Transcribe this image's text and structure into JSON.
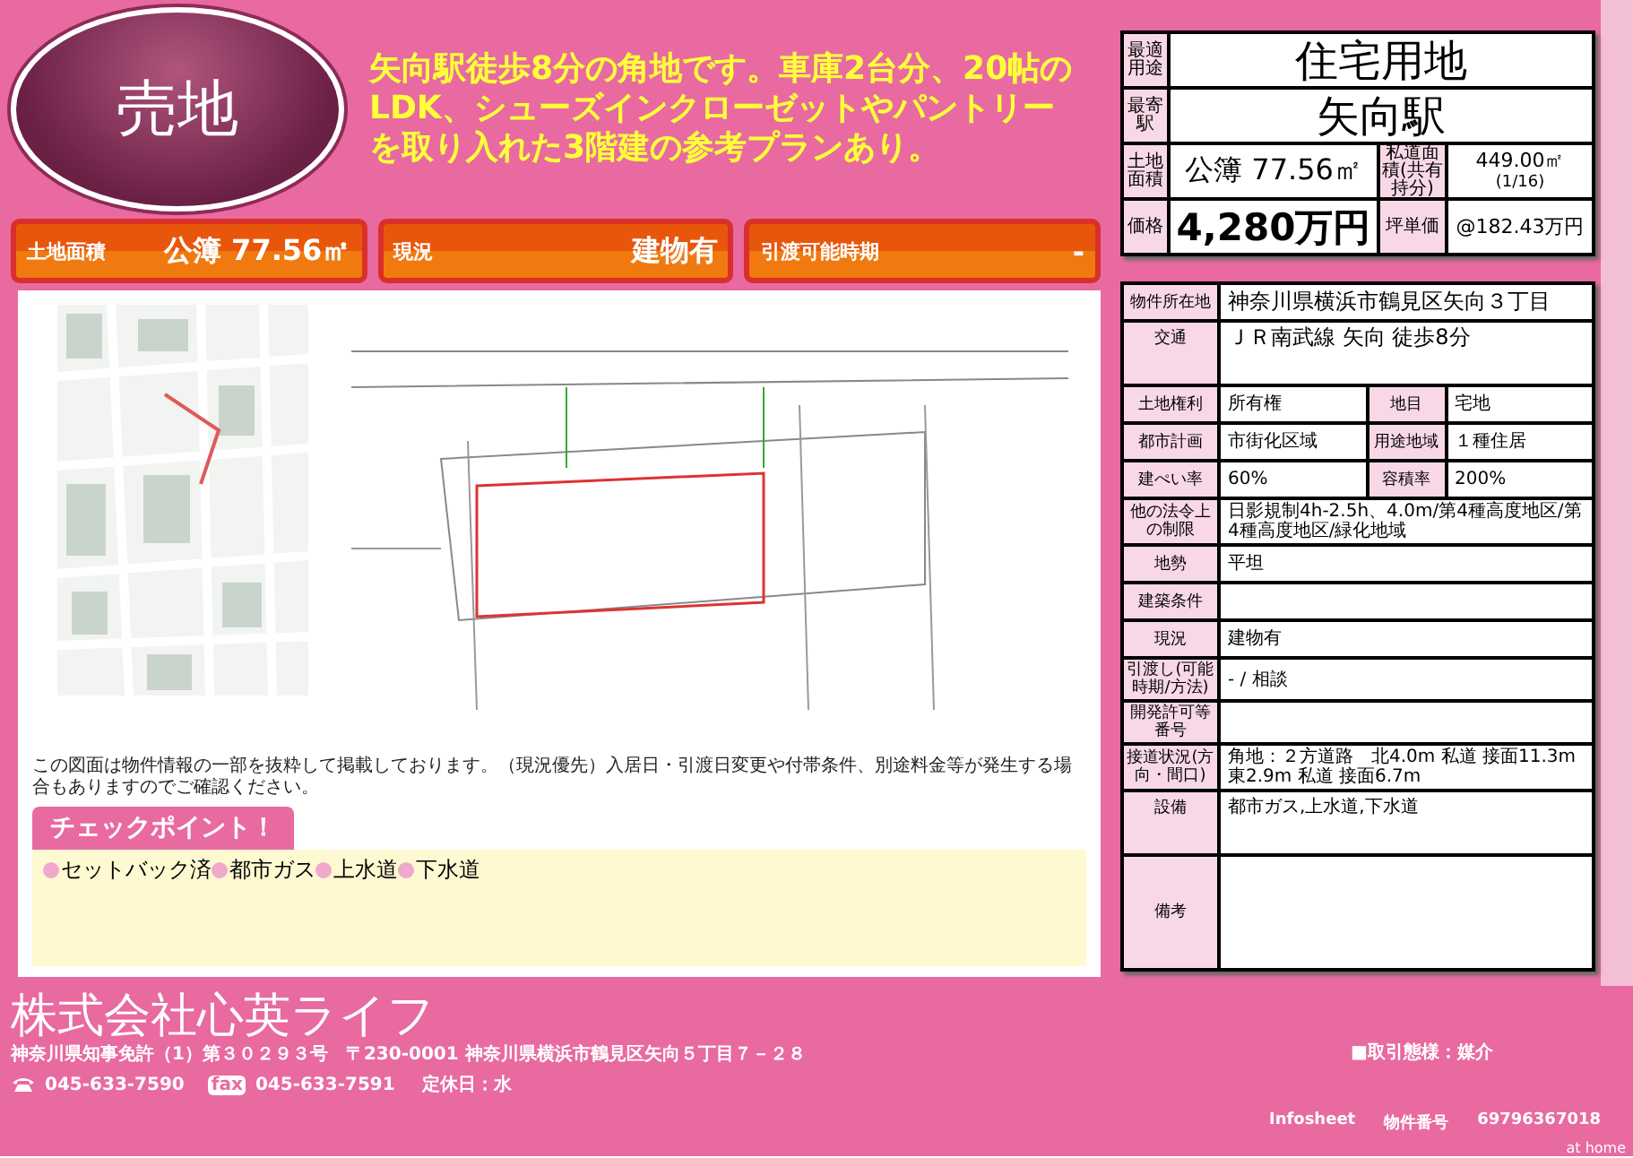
{
  "badge": "売地",
  "headline": "矢向駅徒歩8分の角地です。車庫2台分、20帖のLDK、シューズインクローゼットやパントリーを取り入れた3階建の参考プランあり。",
  "summary_bars": [
    {
      "label": "土地面積",
      "value": "公簿 77.56㎡"
    },
    {
      "label": "現況",
      "value": "建物有"
    },
    {
      "label": "引渡可能時期",
      "value": "-"
    }
  ],
  "notice": "この図面は物件情報の一部を抜粋して掲載しております。（現況優先）入居日・引渡日変更や付帯条件、別途料金等が発生する場合もありますのでご確認ください。",
  "checkpoints": {
    "title": "チェックポイント！",
    "items": [
      "セットバック済",
      "都市ガス",
      "上水道",
      "下水道"
    ]
  },
  "summary_table": {
    "type": {
      "label": "最適用途",
      "value": "住宅用地"
    },
    "station": {
      "label": "最寄駅",
      "value": "矢向駅"
    },
    "land_area": {
      "label": "土地面積",
      "value": "公簿 77.56㎡",
      "sub_label": "私道面積(共有持分)",
      "sub_value": "449.00㎡",
      "sub_note": "(1/16)"
    },
    "price": {
      "label": "価格",
      "value": "4,280万円",
      "sub_label": "坪単価",
      "sub_value": "@182.43万円"
    }
  },
  "details": [
    {
      "kind": "full",
      "label": "物件所在地",
      "value": "神奈川県横浜市鶴見区矢向３丁目"
    },
    {
      "kind": "tall",
      "label": "交通",
      "value": "ＪＲ南武線 矢向 徒歩8分"
    },
    {
      "kind": "pair",
      "label": "土地権利",
      "value": "所有権",
      "label_2": "地目",
      "value_2": "宅地"
    },
    {
      "kind": "pair",
      "label": "都市計画",
      "value": "市街化区域",
      "label_2": "用途地域",
      "value_2": "１種住居"
    },
    {
      "kind": "pair",
      "label": "建ぺい率",
      "value": "60%",
      "label_2": "容積率",
      "value_2": "200%"
    },
    {
      "kind": "full",
      "label": "他の法令上の制限",
      "value": "日影規制4h-2.5h、4.0m/第4種高度地区/第4種高度地区/緑化地域"
    },
    {
      "kind": "full",
      "label": "地勢",
      "value": "平坦"
    },
    {
      "kind": "full",
      "label": "建築条件"
    },
    {
      "kind": "full",
      "label": "現況",
      "value": "建物有"
    },
    {
      "kind": "full",
      "label": "引渡し(可能時期/方法)",
      "value": "- / 相談"
    },
    {
      "kind": "full",
      "label": "開発許可等番号"
    },
    {
      "kind": "full",
      "label": "接道状況(方向・間口)",
      "value": "角地：２方道路　北4.0m 私道 接面11.3m　東2.9m 私道 接面6.7m"
    },
    {
      "kind": "tall",
      "label": "設備",
      "value": "都市ガス,上水道,下水道"
    },
    {
      "kind": "grow",
      "label": "備考"
    }
  ],
  "footer": {
    "company": "株式会社心英ライフ",
    "license": "神奈川県知事免許（1）第３０２９３号　〒230-0001 神奈川県横浜市鶴見区矢向５丁目７－２８",
    "tel": "045-633-7590",
    "fax_label": "fax",
    "fax": "045-633-7591",
    "holiday": "定休日：水",
    "transaction": "■取引態様：媒介",
    "infosheet": "Infosheet",
    "number_label": "物件番号",
    "number": "69796367018",
    "brand": "at home"
  }
}
